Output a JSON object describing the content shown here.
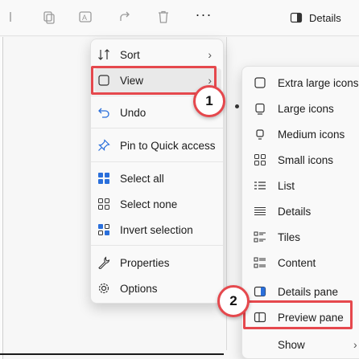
{
  "toolbar": {
    "icons": [
      "cut-icon",
      "copy-icon",
      "rename-icon",
      "share-icon",
      "delete-icon"
    ],
    "more_label": "···",
    "details_label": "Details"
  },
  "context_menu": {
    "items": [
      {
        "label": "Sort",
        "icon": "sort-icon",
        "has_submenu": true
      },
      {
        "label": "View",
        "icon": "view-icon",
        "has_submenu": true
      },
      {
        "label": "Undo",
        "icon": "undo-icon"
      },
      {
        "label": "Pin to Quick access",
        "icon": "pin-icon"
      },
      {
        "label": "Select all",
        "icon": "select-all-icon"
      },
      {
        "label": "Select none",
        "icon": "select-none-icon"
      },
      {
        "label": "Invert selection",
        "icon": "invert-selection-icon"
      },
      {
        "label": "Properties",
        "icon": "properties-icon"
      },
      {
        "label": "Options",
        "icon": "options-icon"
      }
    ]
  },
  "view_submenu": {
    "items": [
      {
        "label": "Extra large icons",
        "icon": "extra-large-icons-icon"
      },
      {
        "label": "Large icons",
        "icon": "large-icons-icon",
        "selected": true
      },
      {
        "label": "Medium icons",
        "icon": "medium-icons-icon"
      },
      {
        "label": "Small icons",
        "icon": "small-icons-icon"
      },
      {
        "label": "List",
        "icon": "list-icon"
      },
      {
        "label": "Details",
        "icon": "details-icon"
      },
      {
        "label": "Tiles",
        "icon": "tiles-icon"
      },
      {
        "label": "Content",
        "icon": "content-icon"
      },
      {
        "label": "Details pane",
        "icon": "details-pane-icon"
      },
      {
        "label": "Preview pane",
        "icon": "preview-pane-icon"
      },
      {
        "label": "Show",
        "icon": "",
        "has_submenu": true
      }
    ]
  },
  "callouts": {
    "step1": "1",
    "step2": "2"
  },
  "colors": {
    "highlight": "#e5484d",
    "menu_bg": "#f9f9f9"
  }
}
